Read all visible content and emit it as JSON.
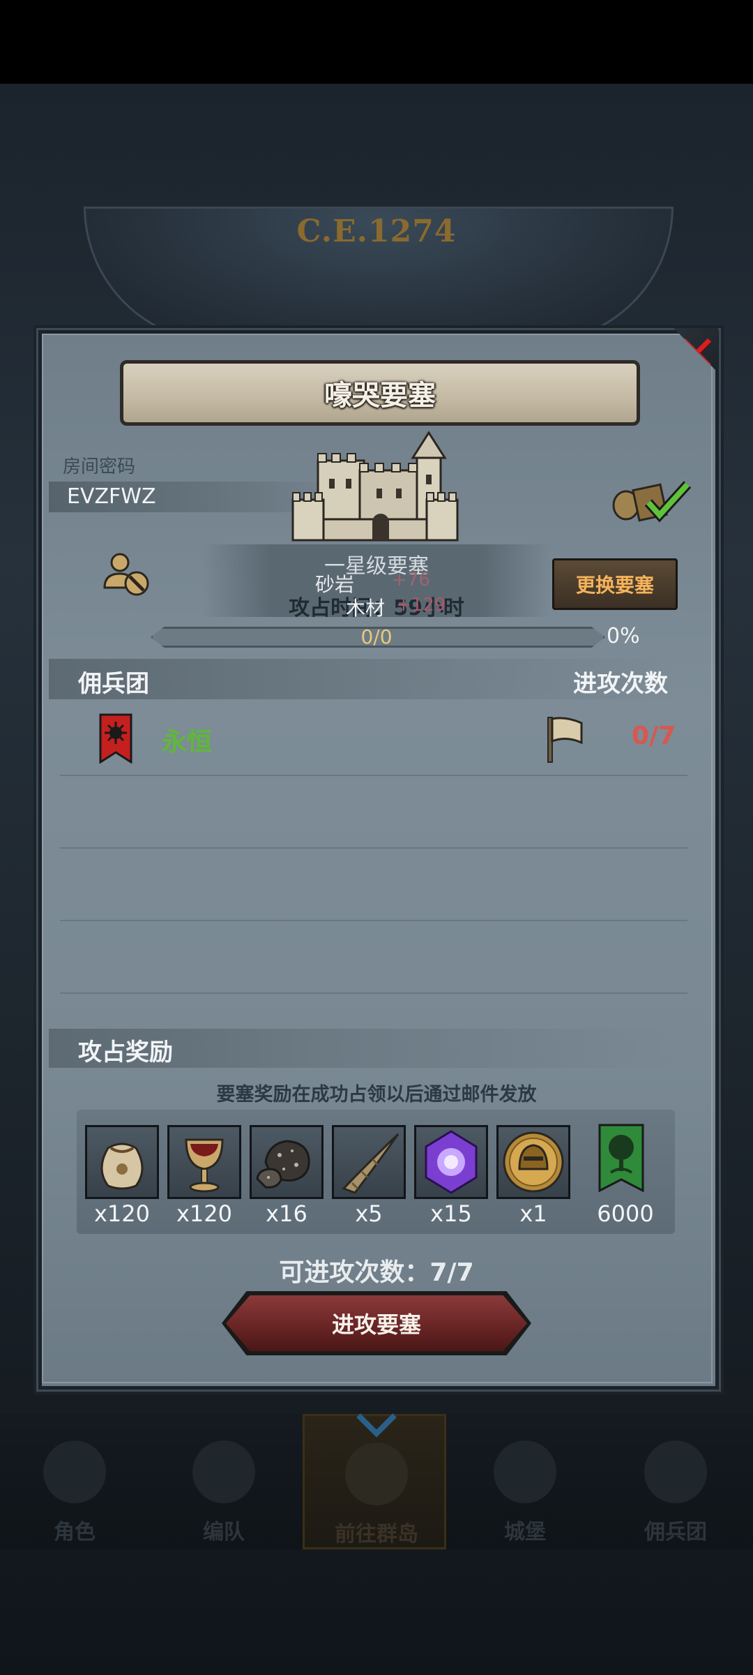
{
  "header": {
    "year": "C.E.1274"
  },
  "modal": {
    "title": "嚎哭要塞",
    "close_icon": "close-x-icon",
    "room_label": "房间密码",
    "room_code": "EVZFWZ",
    "fortress_level": "一星级要塞",
    "resource1_name": "砂岩",
    "resource1_value": "+76",
    "resource2_name": "木材",
    "resource2_value": "+129",
    "occupy_text": "攻占时间：59小时",
    "change_button": "更换要塞",
    "progress_text": "0/0",
    "progress_percent": "0%",
    "progress_value": 0,
    "mercenary_header": "佣兵团",
    "attack_count_header": "进攻次数",
    "guild": {
      "name": "永恒",
      "attacks": "0/7",
      "banner_color": "#c42020"
    },
    "reward_header": "攻占奖励",
    "reward_note": "要塞奖励在成功占领以后通过邮件发放",
    "rewards": [
      {
        "icon": "sack-icon",
        "qty": "x120"
      },
      {
        "icon": "goblet-icon",
        "qty": "x120"
      },
      {
        "icon": "ore-icon",
        "qty": "x16"
      },
      {
        "icon": "horn-icon",
        "qty": "x5"
      },
      {
        "icon": "purple-gem-icon",
        "qty": "x15"
      },
      {
        "icon": "helmet-medal-icon",
        "qty": "x1"
      },
      {
        "icon": "tree-banner-icon",
        "qty": "6000"
      }
    ],
    "attempts_label": "可进攻次数：7/7",
    "attack_button": "进攻要塞"
  },
  "nav": {
    "items": [
      {
        "label": "角色",
        "icon": "knight-icon"
      },
      {
        "label": "编队",
        "icon": "helmet-icon"
      },
      {
        "label": "前往群岛",
        "icon": "globe-icon"
      },
      {
        "label": "城堡",
        "icon": "castle-icon"
      },
      {
        "label": "佣兵团",
        "icon": "ship-icon"
      }
    ]
  },
  "colors": {
    "accent_gold": "#f6b35a",
    "guild_green": "#5fb838",
    "alert_red": "#d8574f",
    "close_red": "#d81f1f"
  }
}
